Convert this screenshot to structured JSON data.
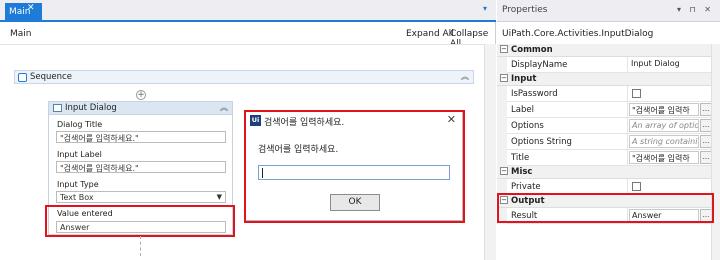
{
  "designer": {
    "tab_label": "Main",
    "tab_close": "✕",
    "tab_menu": "▾",
    "breadcrumb": "Main",
    "expand_all": "Expand All",
    "collapse_all": "Collapse All",
    "sequence_title": "Sequence",
    "collapse_glyph": "︽",
    "add_glyph": "+"
  },
  "activity": {
    "title": "Input Dialog",
    "dialog_title_label": "Dialog Title",
    "dialog_title_value": "\"검색어를 입력하세요.\"",
    "input_label_label": "Input Label",
    "input_label_value": "\"검색어를 입력하세요.\"",
    "input_type_label": "Input Type",
    "input_type_value": "Text Box",
    "dropdown_glyph": "▼",
    "value_entered_label": "Value entered",
    "value_entered_value": "Answer"
  },
  "dialog": {
    "icon_text": "Ui",
    "title": "검색어를 입력하세요.",
    "close": "✕",
    "message": "검색어를 입력하세요.",
    "input_value": "",
    "ok_label": "OK"
  },
  "properties": {
    "header": "Properties",
    "header_controls": "▾ ⊓ ✕",
    "subtitle": "UiPath.Core.Activities.InputDialog",
    "categories": {
      "common": "Common",
      "input": "Input",
      "misc": "Misc",
      "output": "Output"
    },
    "rows": {
      "display_name": {
        "name": "DisplayName",
        "value": "Input Dialog"
      },
      "is_password": {
        "name": "IsPassword"
      },
      "label": {
        "name": "Label",
        "value": "\"검색어를 입력하"
      },
      "options": {
        "name": "Options",
        "value": "An array of option"
      },
      "options_string": {
        "name": "Options String",
        "value": "A string containin"
      },
      "title": {
        "name": "Title",
        "value": "\"검색어를 입력하"
      },
      "private": {
        "name": "Private"
      },
      "result": {
        "name": "Result",
        "value": "Answer"
      }
    },
    "ellipsis": "...",
    "minus": "−"
  },
  "colors": {
    "accent": "#1e7bd8",
    "highlight_border": "#e0141a"
  }
}
